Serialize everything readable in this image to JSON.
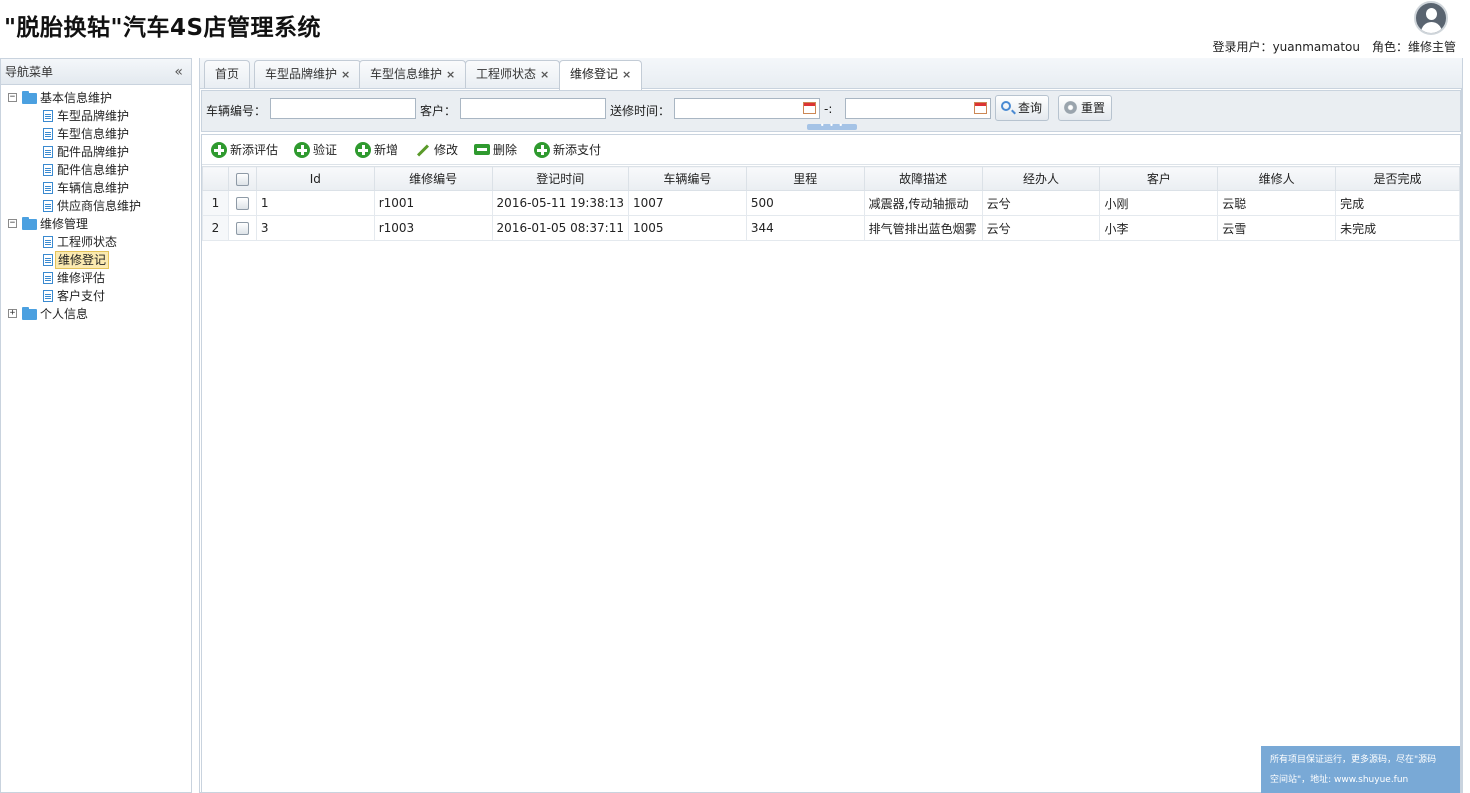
{
  "header": {
    "title": "\"脱胎换轱\"汽车4S店管理系统",
    "login_label": "登录用户：",
    "username": "yuanmamatou",
    "role_label": "角色：",
    "role": "维修主管"
  },
  "nav": {
    "title": "导航菜单",
    "collapse": "«",
    "groups": [
      {
        "toggle": "−",
        "label": "基本信息维护",
        "items": [
          "车型品牌维护",
          "车型信息维护",
          "配件品牌维护",
          "配件信息维护",
          "车辆信息维护",
          "供应商信息维护"
        ]
      },
      {
        "toggle": "−",
        "label": "维修管理",
        "items": [
          "工程师状态",
          "维修登记",
          "维修评估",
          "客户支付"
        ],
        "selected": "维修登记"
      },
      {
        "toggle": "+",
        "label": "个人信息",
        "items": []
      }
    ]
  },
  "tabs": [
    {
      "label": "首页",
      "closable": false
    },
    {
      "label": "车型品牌维护",
      "closable": true
    },
    {
      "label": "车型信息维护",
      "closable": true
    },
    {
      "label": "工程师状态",
      "closable": true
    },
    {
      "label": "维修登记",
      "closable": true,
      "active": true
    }
  ],
  "tab_close": "×",
  "search": {
    "vehicle_no_label": "车辆编号：",
    "vehicle_no_value": "",
    "customer_label": "客户：",
    "customer_value": "",
    "time_label": "送修时间：",
    "time_from": "",
    "range_sep": "-:",
    "time_to": "",
    "query_button": "查询",
    "reset_button": "重置",
    "splitter": "• • •"
  },
  "toolbar": {
    "add_assessment": "新添评估",
    "verify": "验证",
    "add": "新增",
    "edit": "修改",
    "delete": "删除",
    "add_payment": "新添支付"
  },
  "grid": {
    "columns": [
      "Id",
      "维修编号",
      "登记时间",
      "车辆编号",
      "里程",
      "故障描述",
      "经办人",
      "客户",
      "维修人",
      "是否完成"
    ],
    "rows": [
      {
        "rownum": "1",
        "id": "1",
        "repair_no": "r1001",
        "time": "2016-05-11 19:38:13",
        "vehicle": "1007",
        "mileage": "500",
        "fault": "减震器,传动轴振动",
        "handler": "云兮",
        "customer": "小刚",
        "repairer": "云聪",
        "done": "完成"
      },
      {
        "rownum": "2",
        "id": "3",
        "repair_no": "r1003",
        "time": "2016-01-05 08:37:11",
        "vehicle": "1005",
        "mileage": "344",
        "fault": "排气管排出蓝色烟雾",
        "handler": "云兮",
        "customer": "小李",
        "repairer": "云雪",
        "done": "未完成"
      }
    ]
  },
  "watermark": {
    "line1": "所有项目保证运行，更多源码，尽在\"源码",
    "line2": "空间站\"，地址: www.shuyue.fun"
  },
  "colors": {
    "status_text": "#d03030",
    "watermark_bg": "#79a9d6",
    "folder": "#4ba0e0",
    "toolbar_icon": "#2f9a2f"
  }
}
